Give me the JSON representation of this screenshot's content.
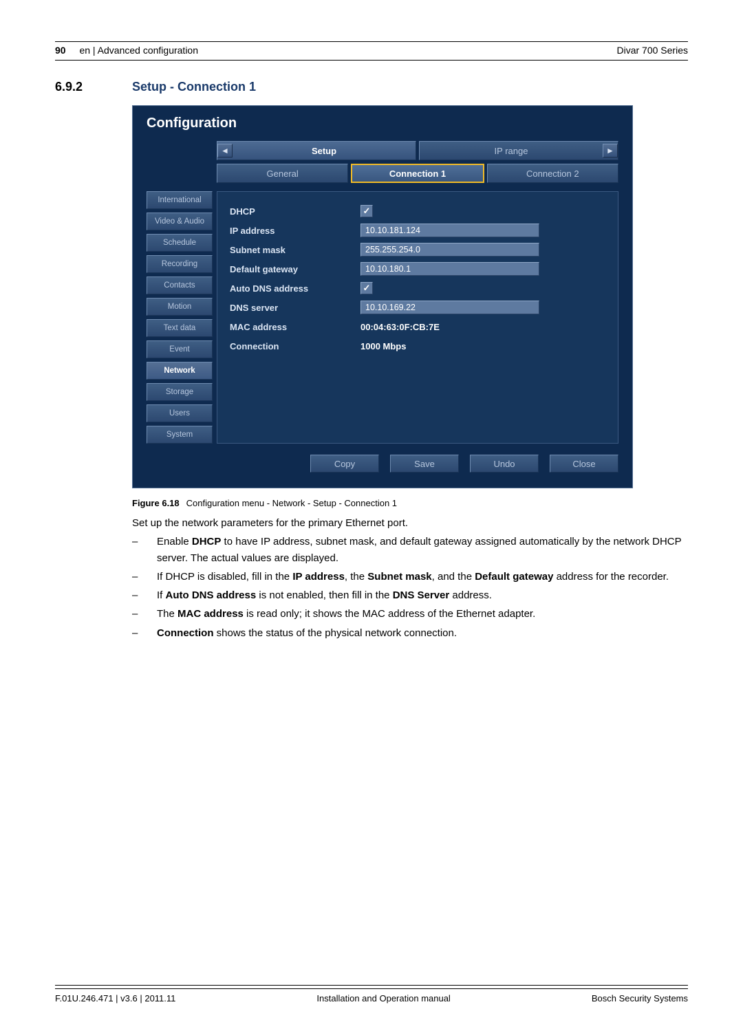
{
  "header": {
    "page_number": "90",
    "left_text": "en | Advanced configuration",
    "right_text": "Divar 700 Series"
  },
  "section": {
    "number": "6.9.2",
    "title": "Setup - Connection 1"
  },
  "panel": {
    "title": "Configuration",
    "main_tabs": {
      "left": "Setup",
      "right": "IP range"
    },
    "sub_tabs": {
      "general": "General",
      "conn1": "Connection 1",
      "conn2": "Connection 2"
    },
    "nav_arrows": {
      "left": "◄",
      "right": "►"
    },
    "menu": {
      "international": "International",
      "video_audio": "Video & Audio",
      "schedule": "Schedule",
      "recording": "Recording",
      "contacts": "Contacts",
      "motion": "Motion",
      "text_data": "Text data",
      "event": "Event",
      "network": "Network",
      "storage": "Storage",
      "users": "Users",
      "system": "System"
    },
    "fields": {
      "dhcp_label": "DHCP",
      "ip_label": "IP address",
      "ip_value": "10.10.181.124",
      "subnet_label": "Subnet mask",
      "subnet_value": "255.255.254.0",
      "gateway_label": "Default gateway",
      "gateway_value": "10.10.180.1",
      "autodns_label": "Auto DNS address",
      "dns_label": "DNS server",
      "dns_value": "10.10.169.22",
      "mac_label": "MAC address",
      "mac_value": "00:04:63:0F:CB:7E",
      "conn_label": "Connection",
      "conn_value": "1000 Mbps"
    },
    "checkmark": "✓",
    "buttons": {
      "copy": "Copy",
      "save": "Save",
      "undo": "Undo",
      "close": "Close"
    }
  },
  "caption": {
    "label": "Figure 6.18",
    "text": "Configuration menu - Network - Setup - Connection 1"
  },
  "body": {
    "intro": "Set up the network parameters for the primary Ethernet port.",
    "bullets": {
      "b1a": "Enable ",
      "b1_bold": "DHCP",
      "b1b": " to have IP address, subnet mask, and default gateway assigned automatically by the network DHCP server. The actual values are displayed.",
      "b2a": "If DHCP is disabled, fill in the ",
      "b2_bold1": "IP address",
      "b2b": ", the ",
      "b2_bold2": "Subnet mask",
      "b2c": ", and the ",
      "b2_bold3": "Default gateway",
      "b2d": " address for the recorder.",
      "b3a": "If ",
      "b3_bold1": "Auto DNS address",
      "b3b": " is not enabled, then fill in the ",
      "b3_bold2": "DNS Server",
      "b3c": " address.",
      "b4a": "The ",
      "b4_bold": "MAC address",
      "b4b": " is read only; it shows the MAC address of the Ethernet adapter.",
      "b5_bold": "Connection",
      "b5a": " shows the status of the physical network connection."
    }
  },
  "footer": {
    "left": "F.01U.246.471 | v3.6 | 2011.11",
    "center": "Installation and Operation manual",
    "right": "Bosch Security Systems"
  }
}
